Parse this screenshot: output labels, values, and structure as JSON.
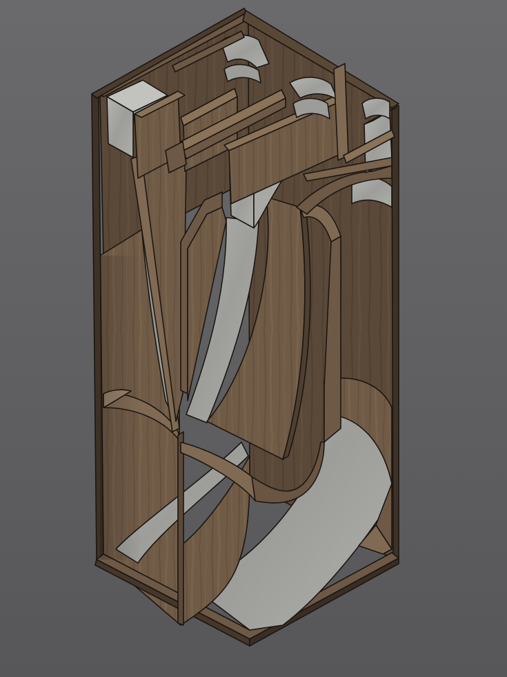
{
  "scene": {
    "subject": "cutaway-horn-loudspeaker-cabinet",
    "background_color": "#5f5f61",
    "wood_color": "#6f5a46",
    "wood_dark_color": "#4f3f31",
    "concrete_color": "#a6a7a3",
    "outline_color": "#1b1612"
  }
}
